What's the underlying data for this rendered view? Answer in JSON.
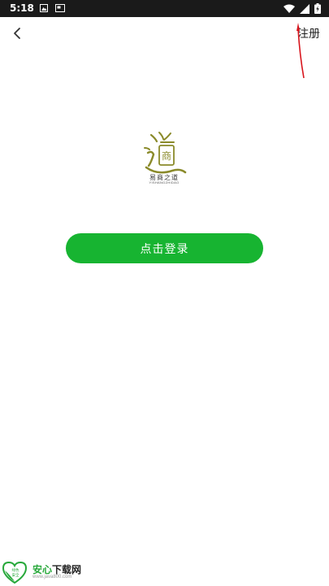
{
  "status_bar": {
    "time": "5:18"
  },
  "nav": {
    "register_label": "注册"
  },
  "logo": {
    "caption": "易商之道",
    "subcaption": "YISHANGZHIDAO",
    "seal_text": "商"
  },
  "login": {
    "button_label": "点击登录"
  },
  "watermark": {
    "name_part1": "安心",
    "name_part2": "下载网",
    "url": "www.java800.com",
    "badge_line1": "绿色",
    "badge_line2": "安全"
  },
  "colors": {
    "primary_green": "#17b431",
    "status_bar_bg": "#1a1a1a",
    "annotation_red": "#d8141c",
    "logo_olive": "#8a8a2a"
  }
}
